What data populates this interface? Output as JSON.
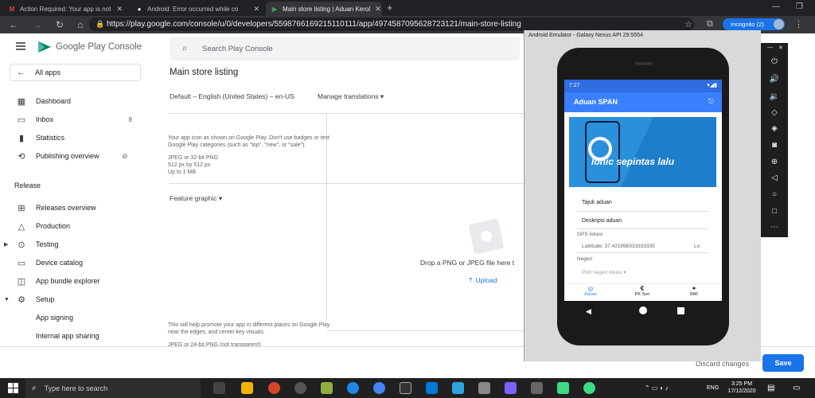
{
  "browser": {
    "tabs": [
      {
        "label": "Action Required: Your app is not",
        "icon": "gmail-icon"
      },
      {
        "label": "Android: Error occurred while co",
        "icon": "github-icon"
      },
      {
        "label": "Main store listing | Aduan Kerol",
        "icon": "play-console-icon"
      }
    ],
    "new_tab": "+",
    "url": "https://play.google.com/console/u/0/developers/5598766169215110111/app/4974587095628723121/main-store-listing",
    "profile": "Incognito (2)"
  },
  "console": {
    "logo": "Google Play Console",
    "search_placeholder": "Search Play Console",
    "all_apps": "All apps",
    "page_title": "Main store listing",
    "language": "Default – English (United States) – en-US",
    "manage_translations": "Manage translations",
    "sidebar": [
      {
        "label": "Dashboard",
        "icon": "dashboard-icon"
      },
      {
        "label": "Inbox",
        "icon": "inbox-icon",
        "count": "8"
      },
      {
        "label": "Statistics",
        "icon": "statistics-icon"
      },
      {
        "label": "Publishing overview",
        "icon": "publishing-icon"
      }
    ],
    "section_release": "Release",
    "release_items": [
      {
        "label": "Releases overview",
        "icon": "releases-icon"
      },
      {
        "label": "Production",
        "icon": "production-icon"
      },
      {
        "label": "Testing",
        "icon": "testing-icon"
      },
      {
        "label": "Device catalog",
        "icon": "device-icon"
      },
      {
        "label": "App bundle explorer",
        "icon": "bundle-icon"
      },
      {
        "label": "Setup",
        "icon": "setup-icon"
      },
      {
        "label": "App signing",
        "icon": ""
      },
      {
        "label": "Internal app sharing",
        "icon": ""
      }
    ],
    "icon_note": [
      "Your app icon as shown on Google Play. Don't use badges or text",
      "Google Play categories (such as \"top\", \"new\", or \"sale\")."
    ],
    "icon_specs": [
      "JPEG or 32-bit PNG",
      "512 px by 512 px",
      "Up to 1 MB"
    ],
    "feature_graphic": "Feature graphic",
    "drop_text": "Drop a PNG or JPEG file here t",
    "upload": "Upload",
    "feature_note": [
      "This will help promote your app in different places on Google Play",
      "near the edges, and center key visuals."
    ],
    "feature_spec": "JPEG or 24-bit PNG (not transparent)",
    "discard": "Discard changes",
    "save": "Save"
  },
  "emulator": {
    "title": "Android Emulator - Galaxy Nexus API 29:5554",
    "status_time": "7:27",
    "app_title": "Aduan SPAN",
    "banner_text": "Ionic sepintas lalu",
    "field_title": "Tajuk aduan",
    "field_desc": "Deskripsi aduan",
    "gps_label": "GPS lokasi",
    "gps_value": "Lattitude: 37.421998333333335",
    "gps_extra": "Lo",
    "state_label": "Negeri",
    "state_value": "Pilih negeri lokasi",
    "tabs": [
      {
        "label": "Aduan",
        "icon": "aduan-icon",
        "active": true
      },
      {
        "label": "PK Sen",
        "icon": "euro-icon",
        "active": false
      },
      {
        "label": "BMI",
        "icon": "person-icon",
        "active": false
      }
    ]
  },
  "taskbar": {
    "search": "Type here to search",
    "lang": "ENG",
    "time": "3:25 PM",
    "date": "17/12/2020"
  },
  "colors": {
    "accent": "#1a73e8",
    "app_bar": "#3880ff"
  }
}
